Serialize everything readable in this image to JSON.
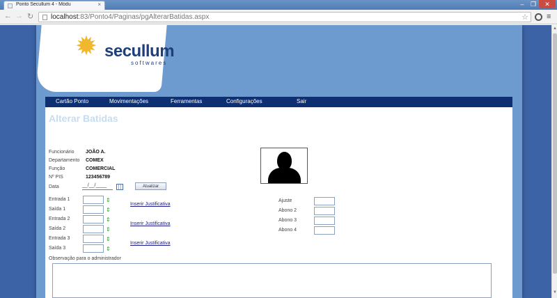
{
  "browser": {
    "tab_title": "Ponto Secullum 4 - Módu",
    "url_host": "localhost",
    "url_rest": ":83/Ponto4/Paginas/pgAlterarBatidas.aspx"
  },
  "logo": {
    "name": "secullum",
    "sub": "softwares",
    "star": "✹"
  },
  "nav": [
    "Cartão Ponto",
    "Movimentações",
    "Ferramentas",
    "Configurações",
    "Sair"
  ],
  "page": {
    "title": "Alterar Batidas"
  },
  "employee": {
    "funcionario_label": "Funcionário",
    "funcionario_value": "JOÃO A.",
    "departamento_label": "Departamento",
    "departamento_value": "COMEX",
    "funcao_label": "Função",
    "funcao_value": "COMERCIAL",
    "pis_label": "Nº PIS",
    "pis_value": "123456789"
  },
  "date": {
    "label": "Data",
    "value": "__/__/____",
    "update_button": "Atualizar"
  },
  "entries": [
    {
      "label": "Entrada 1"
    },
    {
      "label": "Saída 1"
    },
    {
      "label": "Entrada 2"
    },
    {
      "label": "Saída 2"
    },
    {
      "label": "Entrada 3"
    },
    {
      "label": "Saída 3"
    }
  ],
  "justify_link": "Inserir Justificativa",
  "ajustes": {
    "ajuste_label": "Ajuste",
    "abono2_label": "Abono 2",
    "abono3_label": "Abono 3",
    "abono4_label": "Abono 4"
  },
  "observation_label": "Observação para o administrador",
  "icons": {
    "arrow": "⇕",
    "back": "←",
    "forward": "→",
    "reload": "↻",
    "star": "☆",
    "menu": "≡"
  },
  "colors": {
    "page_background": "#3c63a6",
    "container": "#6d9bcf",
    "navbar": "#0f2f73",
    "title": "#c8dcef",
    "logo_star": "#f1b82d",
    "logo_text": "#1f3f7a"
  }
}
